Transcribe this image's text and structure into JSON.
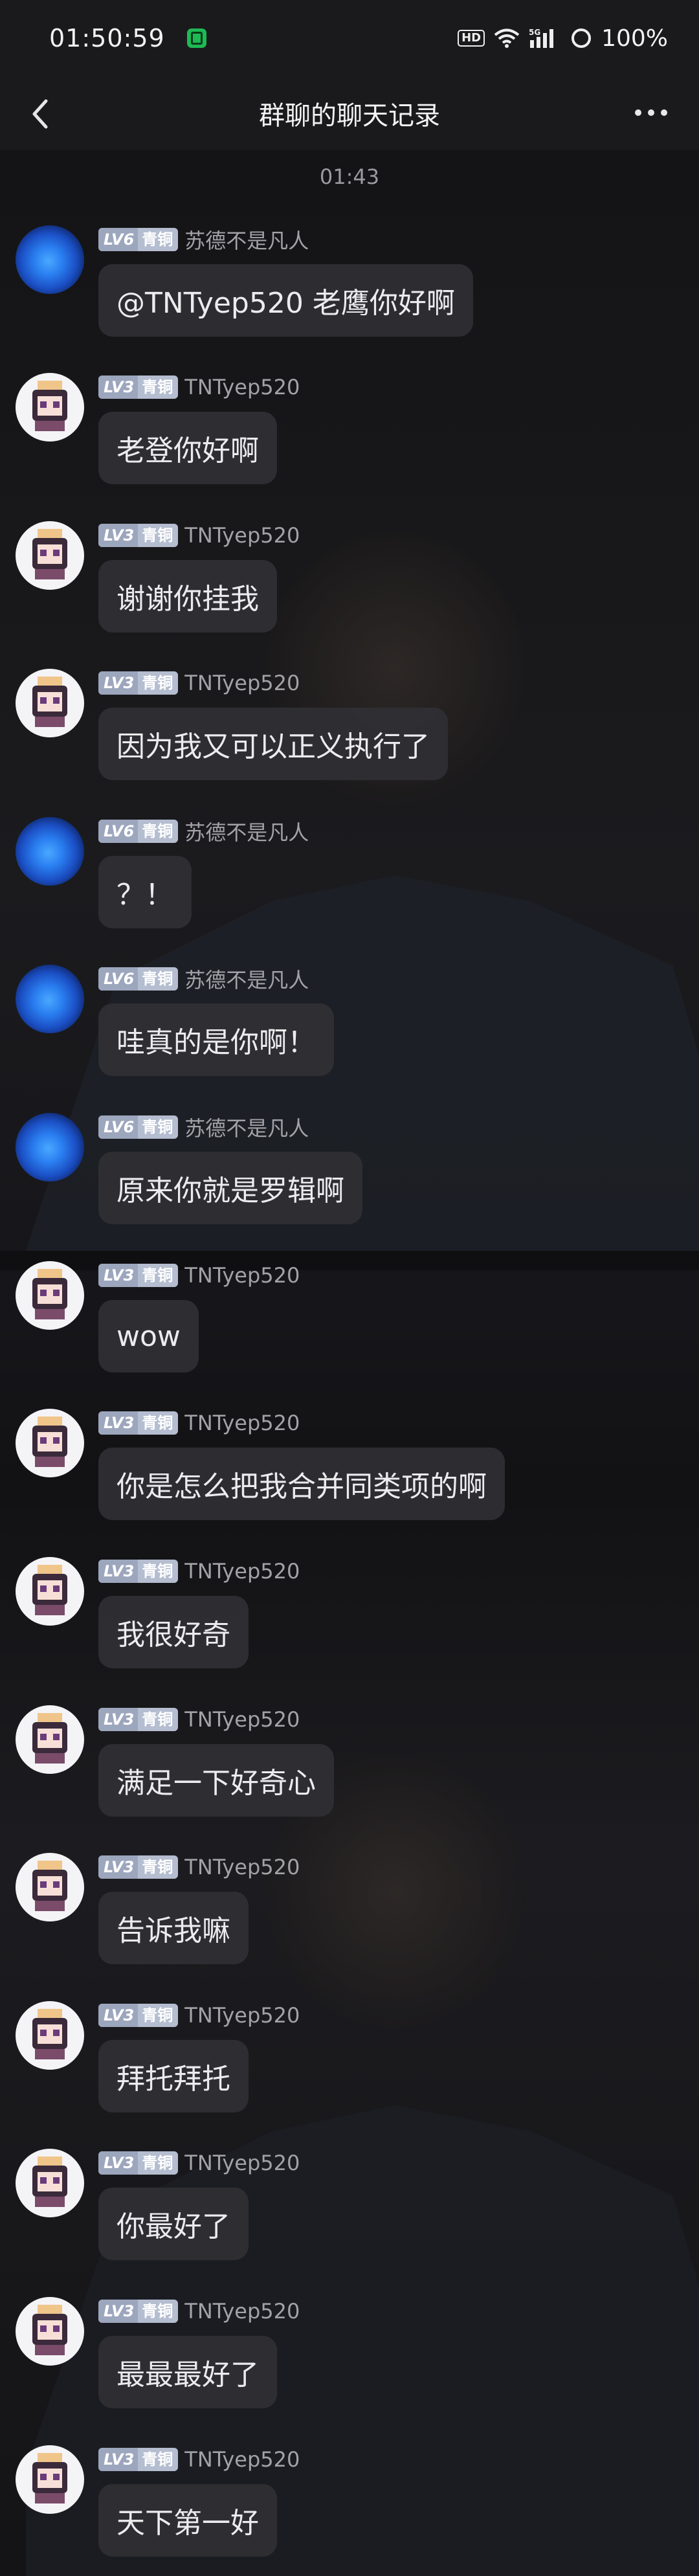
{
  "status_bar": {
    "time": "01:50:59",
    "hd": "HD",
    "network": "5G",
    "battery": "100%"
  },
  "header": {
    "title": "群聊的聊天记录",
    "back_icon": "chevron-left-icon",
    "more_icon": "more-dots-icon"
  },
  "chat": {
    "timestamp": "01:43",
    "messages": [
      {
        "sender": "苏德不是凡人",
        "level": "LV6",
        "rank": "青铜",
        "avatar": "blue-orb",
        "text": "@TNTyep520 老鹰你好啊"
      },
      {
        "sender": "TNTyep520",
        "level": "LV3",
        "rank": "青铜",
        "avatar": "anime-girl",
        "text": "老登你好啊"
      },
      {
        "sender": "TNTyep520",
        "level": "LV3",
        "rank": "青铜",
        "avatar": "anime-girl",
        "text": "谢谢你挂我"
      },
      {
        "sender": "TNTyep520",
        "level": "LV3",
        "rank": "青铜",
        "avatar": "anime-girl",
        "text": "因为我又可以正义执行了"
      },
      {
        "sender": "苏德不是凡人",
        "level": "LV6",
        "rank": "青铜",
        "avatar": "blue-orb",
        "text": "？！"
      },
      {
        "sender": "苏德不是凡人",
        "level": "LV6",
        "rank": "青铜",
        "avatar": "blue-orb",
        "text": "哇真的是你啊！"
      },
      {
        "sender": "苏德不是凡人",
        "level": "LV6",
        "rank": "青铜",
        "avatar": "blue-orb",
        "text": "原来你就是罗辑啊"
      },
      {
        "sender": "TNTyep520",
        "level": "LV3",
        "rank": "青铜",
        "avatar": "anime-girl",
        "text": "wow"
      },
      {
        "sender": "TNTyep520",
        "level": "LV3",
        "rank": "青铜",
        "avatar": "anime-girl",
        "text": "你是怎么把我合并同类项的啊"
      },
      {
        "sender": "TNTyep520",
        "level": "LV3",
        "rank": "青铜",
        "avatar": "anime-girl",
        "text": "我很好奇"
      },
      {
        "sender": "TNTyep520",
        "level": "LV3",
        "rank": "青铜",
        "avatar": "anime-girl",
        "text": "满足一下好奇心"
      },
      {
        "sender": "TNTyep520",
        "level": "LV3",
        "rank": "青铜",
        "avatar": "anime-girl",
        "text": "告诉我嘛"
      },
      {
        "sender": "TNTyep520",
        "level": "LV3",
        "rank": "青铜",
        "avatar": "anime-girl",
        "text": "拜托拜托"
      },
      {
        "sender": "TNTyep520",
        "level": "LV3",
        "rank": "青铜",
        "avatar": "anime-girl",
        "text": "你最好了"
      },
      {
        "sender": "TNTyep520",
        "level": "LV3",
        "rank": "青铜",
        "avatar": "anime-girl",
        "text": "最最最好了"
      },
      {
        "sender": "TNTyep520",
        "level": "LV3",
        "rank": "青铜",
        "avatar": "anime-girl",
        "text": "天下第一好"
      }
    ]
  }
}
